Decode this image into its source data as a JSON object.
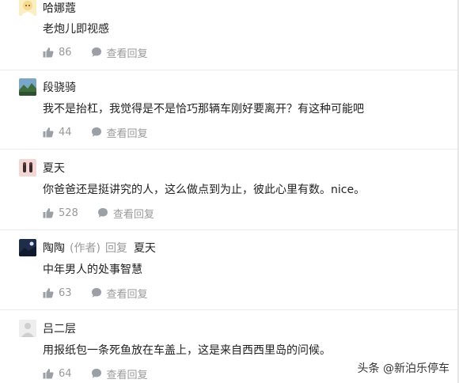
{
  "comments": [
    {
      "username": "哈娜蔻",
      "text": "老炮儿即视感",
      "likes": "86",
      "view_replies": "查看回复"
    },
    {
      "username": "段骁骑",
      "text": "我不是抬杠，我觉得是不是恰巧那辆车刚好要离开？有这种可能吧",
      "likes": "44",
      "view_replies": "查看回复"
    },
    {
      "username": "夏天",
      "text": "你爸爸还是挺讲究的人，这么做点到为止，彼此心里有数。nice。",
      "likes": "528",
      "view_replies": "查看回复"
    },
    {
      "username": "陶陶",
      "author_tag": "(作者)",
      "reply_word": "回复",
      "reply_target": "夏天",
      "text": "中年男人的处事智慧",
      "likes": "63",
      "view_replies": "查看回复"
    },
    {
      "username": "吕二层",
      "text": "用报纸包一条死鱼放在车盖上，这是来自西西里岛的问候。",
      "likes": "64",
      "view_replies": "查看回复"
    }
  ],
  "watermark": "头条 @新泊乐停车",
  "colors": {
    "text": "#222222",
    "muted": "#999999",
    "divider": "#ececec"
  }
}
